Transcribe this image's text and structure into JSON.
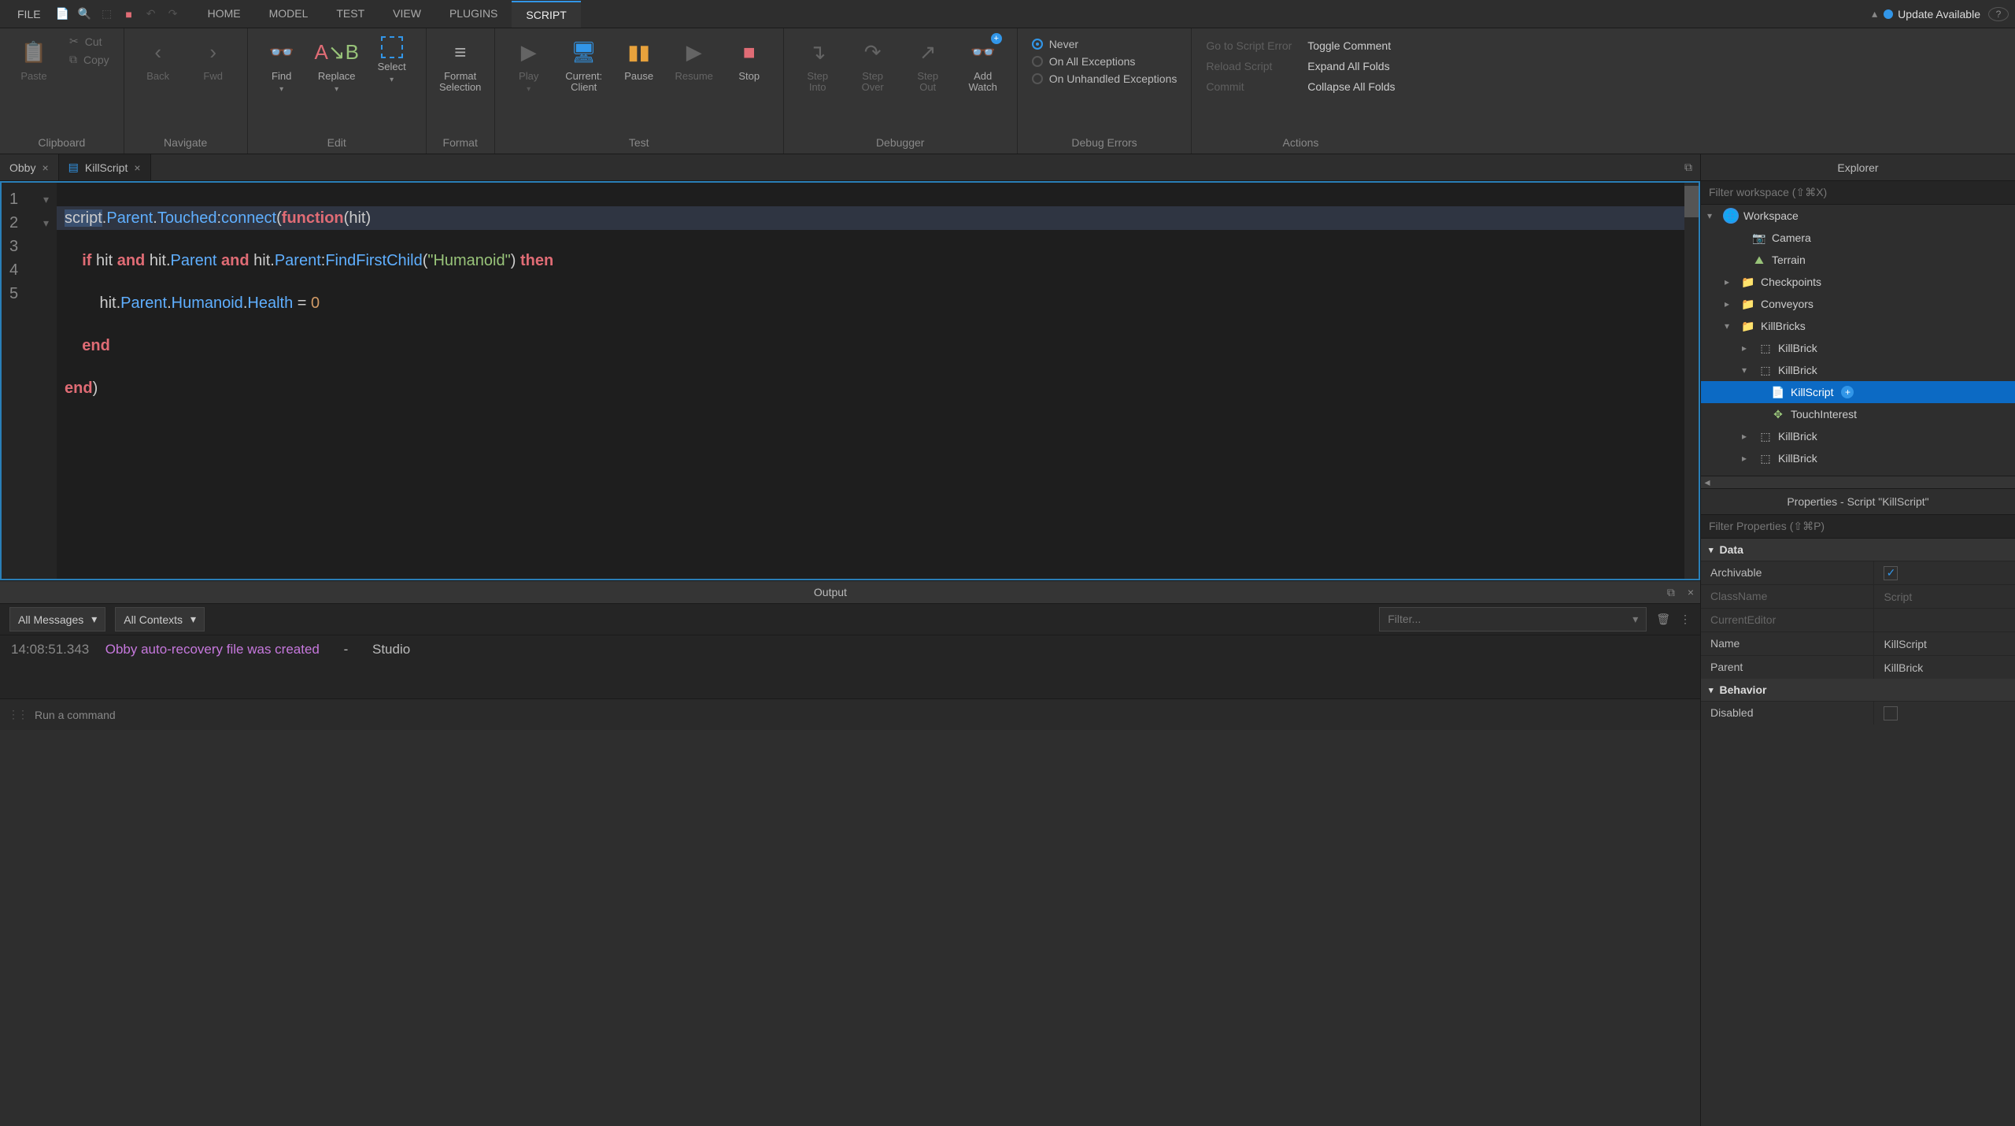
{
  "menubar": {
    "file": "FILE",
    "tabs": [
      "HOME",
      "MODEL",
      "TEST",
      "VIEW",
      "PLUGINS",
      "SCRIPT"
    ],
    "active_tab": "SCRIPT",
    "update": "Update Available"
  },
  "ribbon": {
    "clipboard": {
      "paste": "Paste",
      "cut": "Cut",
      "copy": "Copy",
      "label": "Clipboard"
    },
    "navigate": {
      "back": "Back",
      "fwd": "Fwd",
      "label": "Navigate"
    },
    "edit": {
      "find": "Find",
      "replace": "Replace",
      "select": "Select",
      "label": "Edit"
    },
    "format": {
      "format_selection": "Format\nSelection",
      "label": "Format"
    },
    "test": {
      "play": "Play",
      "current_client": "Current:\nClient",
      "pause": "Pause",
      "resume": "Resume",
      "stop": "Stop",
      "label": "Test"
    },
    "debugger": {
      "step_into": "Step\nInto",
      "step_over": "Step\nOver",
      "step_out": "Step\nOut",
      "add_watch": "Add\nWatch",
      "label": "Debugger"
    },
    "debug_errors": {
      "never": "Never",
      "on_all": "On All Exceptions",
      "on_unhandled": "On Unhandled Exceptions",
      "label": "Debug Errors"
    },
    "actions": {
      "goto": "Go to Script Error",
      "reload": "Reload Script",
      "commit": "Commit",
      "toggle": "Toggle Comment",
      "expand": "Expand All Folds",
      "collapse": "Collapse All Folds",
      "label": "Actions"
    }
  },
  "doc_tabs": {
    "tab1": "Obby",
    "tab2": "KillScript"
  },
  "code": {
    "l1": {
      "a": "script",
      "b": ".",
      "c": "Parent",
      "d": ".",
      "e": "Touched",
      "f": ":",
      "g": "connect",
      "h": "(",
      "i": "function",
      "j": "(hit)"
    },
    "l2": {
      "a": "    ",
      "kw1": "if",
      "b": " hit ",
      "kw2": "and",
      "c": " hit.",
      "d": "Parent",
      "e": " ",
      "kw3": "and",
      "f": " hit.",
      "g": "Parent",
      "h": ":",
      "i": "FindFirstChild",
      "j": "(",
      "k": "\"Humanoid\"",
      "l": ") ",
      "kw4": "then"
    },
    "l3": {
      "a": "        hit.",
      "b": "Parent",
      "c": ".",
      "d": "Humanoid",
      "e": ".",
      "f": "Health",
      "g": " = ",
      "h": "0"
    },
    "l4": {
      "a": "    ",
      "kw": "end"
    },
    "l5": {
      "kw": "end",
      "a": ")"
    }
  },
  "output": {
    "title": "Output",
    "all_messages": "All Messages",
    "all_contexts": "All Contexts",
    "filter_placeholder": "Filter...",
    "time": "14:08:51.343",
    "msg": "Obby auto-recovery file was created",
    "sep": "-",
    "src": "Studio"
  },
  "cmd": {
    "placeholder": "Run a command"
  },
  "explorer": {
    "title": "Explorer",
    "filter": "Filter workspace (⇧⌘X)",
    "nodes": {
      "workspace": "Workspace",
      "camera": "Camera",
      "terrain": "Terrain",
      "checkpoints": "Checkpoints",
      "conveyors": "Conveyors",
      "killbricks": "KillBricks",
      "killbrick": "KillBrick",
      "killscript": "KillScript",
      "touchinterest": "TouchInterest"
    }
  },
  "properties": {
    "title": "Properties - Script \"KillScript\"",
    "filter": "Filter Properties (⇧⌘P)",
    "sections": {
      "data": "Data",
      "behavior": "Behavior"
    },
    "rows": {
      "archivable": "Archivable",
      "classname": "ClassName",
      "classname_v": "Script",
      "currenteditor": "CurrentEditor",
      "name": "Name",
      "name_v": "KillScript",
      "parent": "Parent",
      "parent_v": "KillBrick",
      "disabled": "Disabled"
    }
  }
}
